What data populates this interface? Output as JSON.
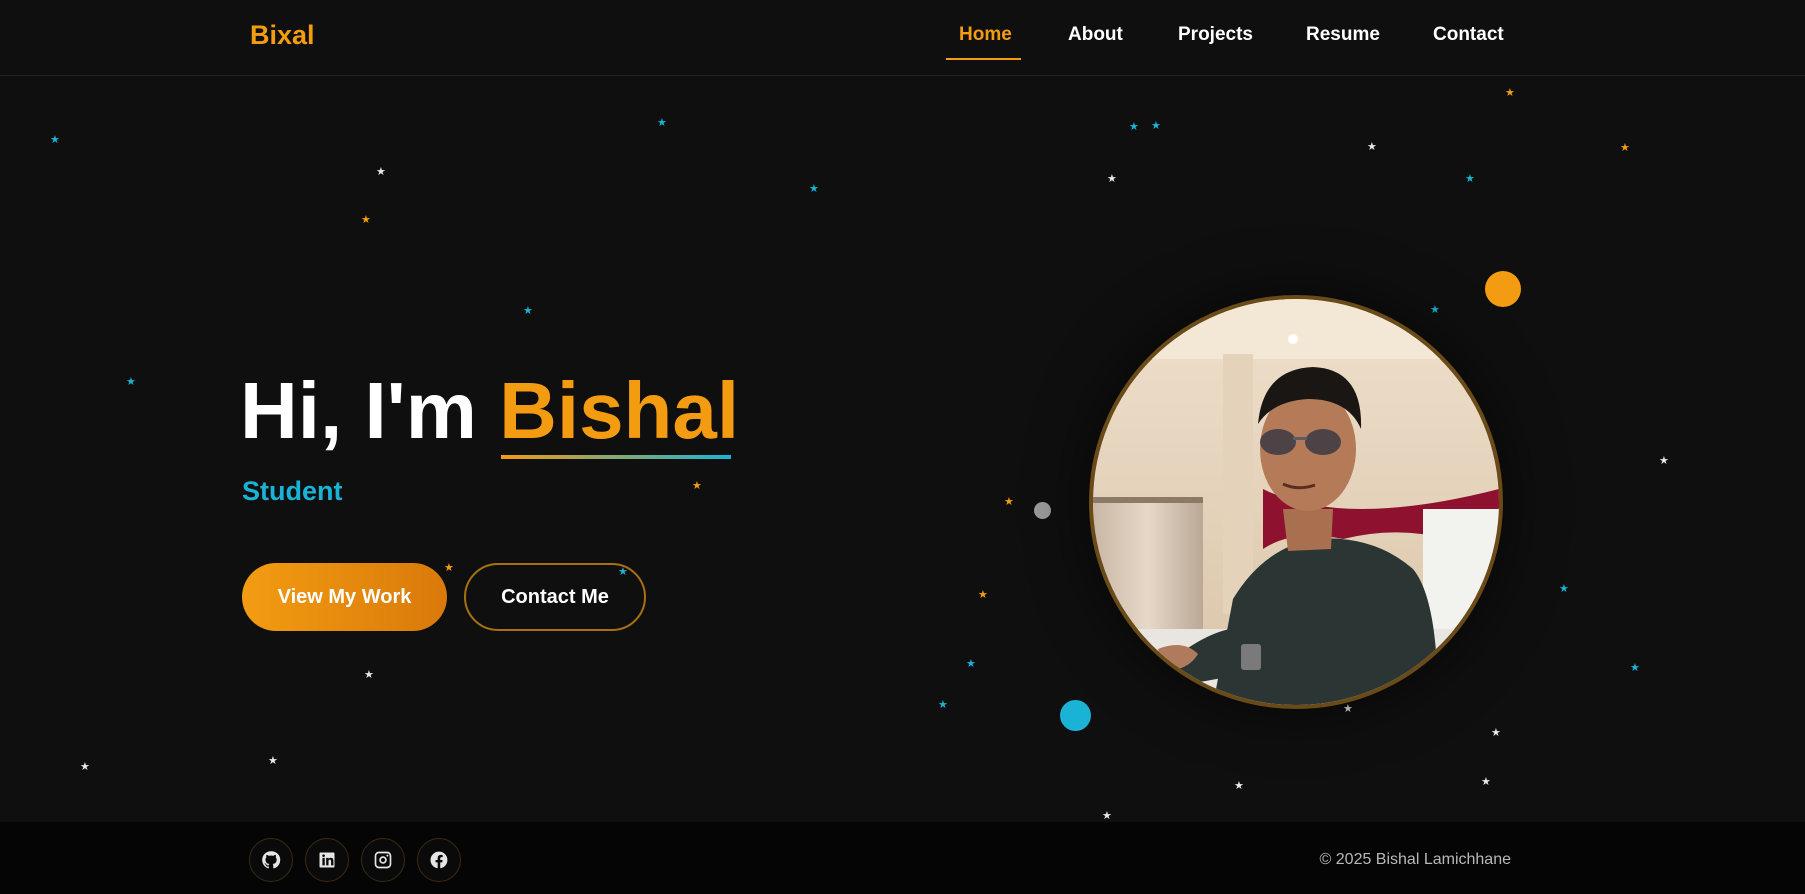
{
  "brand": {
    "logo": "Bixal"
  },
  "nav": {
    "items": [
      {
        "label": "Home",
        "active": true
      },
      {
        "label": "About"
      },
      {
        "label": "Projects"
      },
      {
        "label": "Resume"
      },
      {
        "label": "Contact"
      }
    ]
  },
  "hero": {
    "greeting": "Hi, I'm ",
    "name": "Bishal",
    "role": "Student",
    "primary_button": "View My Work",
    "secondary_button": "Contact Me"
  },
  "footer": {
    "social": [
      {
        "icon": "github-icon"
      },
      {
        "icon": "linkedin-icon"
      },
      {
        "icon": "instagram-icon"
      },
      {
        "icon": "facebook-icon"
      }
    ],
    "copyright": "© 2025 Bishal Lamichhane"
  },
  "colors": {
    "accent": "#f39c12",
    "secondary": "#1ab3d6",
    "background": "#0f0f0f"
  }
}
